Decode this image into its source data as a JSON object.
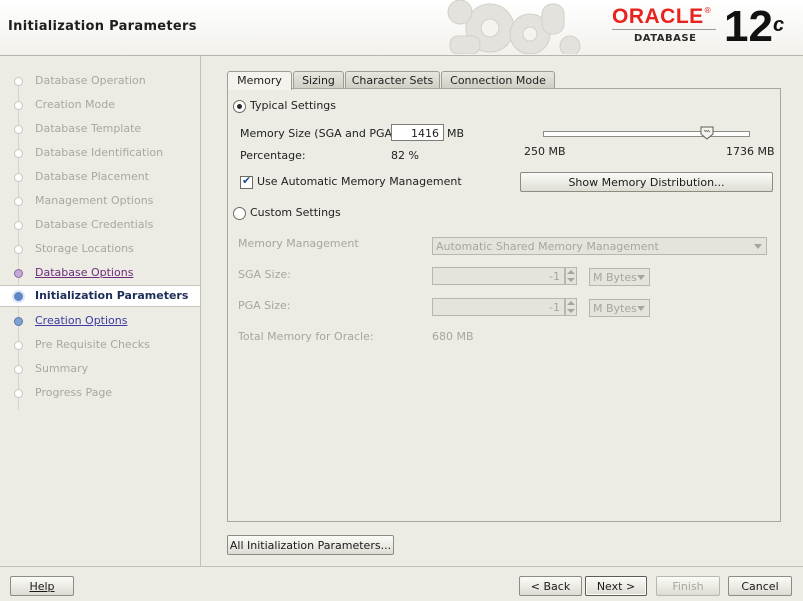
{
  "window": {
    "title": "Initialization Parameters"
  },
  "branding": {
    "oracle": "ORACLE",
    "registered": "®",
    "database": "DATABASE",
    "version": "12",
    "version_suffix": "c"
  },
  "steps": [
    {
      "label": "Database Operation",
      "state": "done"
    },
    {
      "label": "Creation Mode",
      "state": "done"
    },
    {
      "label": "Database Template",
      "state": "done"
    },
    {
      "label": "Database Identification",
      "state": "done"
    },
    {
      "label": "Database Placement",
      "state": "done"
    },
    {
      "label": "Management Options",
      "state": "done"
    },
    {
      "label": "Database Credentials",
      "state": "done"
    },
    {
      "label": "Storage Locations",
      "state": "done"
    },
    {
      "label": "Database Options",
      "state": "link-visited"
    },
    {
      "label": "Initialization Parameters",
      "state": "current"
    },
    {
      "label": "Creation Options",
      "state": "link"
    },
    {
      "label": "Pre Requisite Checks",
      "state": "future"
    },
    {
      "label": "Summary",
      "state": "future"
    },
    {
      "label": "Progress Page",
      "state": "future"
    }
  ],
  "tabs": [
    {
      "label": "Memory",
      "active": true
    },
    {
      "label": "Sizing",
      "active": false
    },
    {
      "label": "Character Sets",
      "active": false
    },
    {
      "label": "Connection Mode",
      "active": false
    }
  ],
  "memory": {
    "typical_label": "Typical Settings",
    "memory_size_label": "Memory Size (SGA and PGA):",
    "memory_size_value": "1416",
    "memory_unit": "MB",
    "percentage_label": "Percentage:",
    "percentage_value": "82 %",
    "slider_min": "250 MB",
    "slider_max": "1736 MB",
    "slider_fraction": 0.79,
    "auto_mem_label": "Use Automatic Memory Management",
    "auto_mem_checked": true,
    "show_dist_button": "Show Memory Distribution...",
    "custom_label": "Custom Settings",
    "mem_mgmt_label": "Memory Management",
    "mem_mgmt_value": "Automatic Shared Memory Management",
    "sga_label": "SGA Size:",
    "sga_value": "-1",
    "sga_unit": "M Bytes",
    "pga_label": "PGA Size:",
    "pga_value": "-1",
    "pga_unit": "M Bytes",
    "total_label": "Total Memory for Oracle:",
    "total_value": "680 MB"
  },
  "buttons": {
    "all_params": "All Initialization Parameters...",
    "help": "Help",
    "back": "< Back",
    "next": "Next >",
    "finish": "Finish",
    "cancel": "Cancel"
  }
}
